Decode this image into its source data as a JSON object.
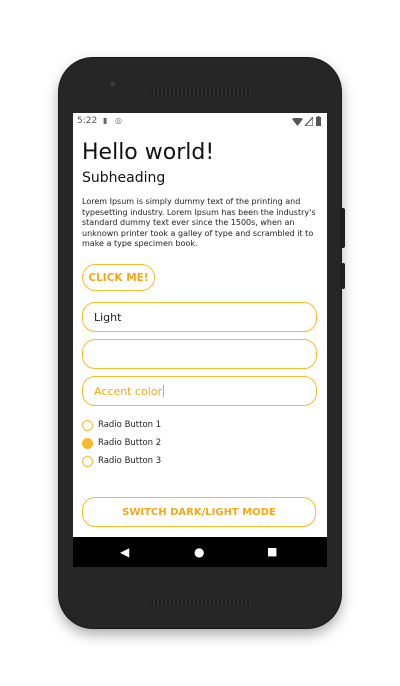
{
  "status_bar": {
    "time": "5:22",
    "left_icons": [
      "sd-card-icon",
      "sync-icon"
    ],
    "right_icons": [
      "wifi-icon",
      "signal-icon",
      "battery-icon"
    ]
  },
  "main": {
    "title": "Hello world!",
    "subheading": "Subheading",
    "body": "Lorem Ipsum is simply dummy text of the printing and typesetting industry. Lorem Ipsum has been the industry's standard dummy text ever since the 1500s, when an unknown printer took a galley of type and scrambled it to make a type specimen book.",
    "click_button_label": "CLICK ME!",
    "fields": {
      "theme_value": "Light",
      "empty_value": "",
      "accent_value": "Accent color"
    },
    "radio_buttons": [
      {
        "label": "Radio Button 1",
        "checked": false
      },
      {
        "label": "Radio Button 2",
        "checked": true
      },
      {
        "label": "Radio Button 3",
        "checked": false
      }
    ],
    "switch_button_label": "SWITCH DARK/LIGHT MODE"
  },
  "nav_bar": {
    "back": "◀",
    "home": "●",
    "recents": "■"
  },
  "colors": {
    "accent": "#FBBA28",
    "accent_text": "#F7A716",
    "phone_body": "#262626",
    "nav_bar": "#000000"
  }
}
